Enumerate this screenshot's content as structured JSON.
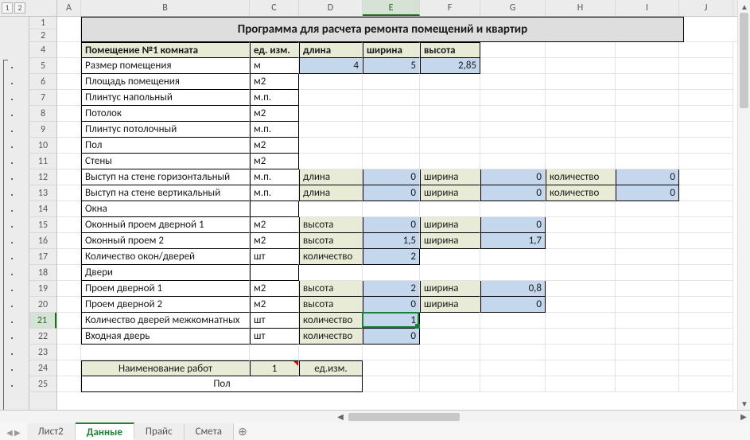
{
  "outline_levels": [
    "1",
    "2"
  ],
  "columns": [
    "A",
    "B",
    "C",
    "D",
    "E",
    "F",
    "G",
    "H",
    "I",
    "J"
  ],
  "selected_column": "E",
  "row_numbers": [
    1,
    2,
    4,
    5,
    6,
    7,
    8,
    9,
    10,
    11,
    12,
    13,
    14,
    15,
    16,
    17,
    18,
    19,
    20,
    21,
    22,
    23,
    24,
    25
  ],
  "selected_row": 21,
  "title": "Программа для расчета ремонта помещений и квартир",
  "header4": {
    "B": "Помещение №1 комната",
    "C": "ед. изм.",
    "D": "длина",
    "E": "ширина",
    "F": "высота"
  },
  "rows5_11": [
    {
      "b": "Размер помещения",
      "c": "м",
      "d": "4",
      "e": "5",
      "f": "2,85"
    },
    {
      "b": "Площадь помещения",
      "c": "м2"
    },
    {
      "b": "Плинтус напольный",
      "c": "м.п."
    },
    {
      "b": "Потолок",
      "c": "м2"
    },
    {
      "b": "Плинтус потолочный",
      "c": "м.п."
    },
    {
      "b": "Пол",
      "c": "м2"
    },
    {
      "b": "Стены",
      "c": "м2"
    }
  ],
  "row12": {
    "b": "Выступ на стене горизонтальный",
    "c": "м.п.",
    "d": "длина",
    "e": "0",
    "f": "ширина",
    "g": "0",
    "h": "количество",
    "i": "0"
  },
  "row13": {
    "b": "Выступ на стене вертикальный",
    "c": "м.п.",
    "d": "длина",
    "e": "0",
    "f": "ширина",
    "g": "0",
    "h": "количество",
    "i": "0"
  },
  "row14": {
    "b": "Окна"
  },
  "row15": {
    "b": "Оконный проем дверной 1",
    "c": "м2",
    "d": "высота",
    "e": "0",
    "f": "ширина",
    "g": "0"
  },
  "row16": {
    "b": "Оконный проем 2",
    "c": "м2",
    "d": "высота",
    "e": "1,5",
    "f": "ширина",
    "g": "1,7"
  },
  "row17": {
    "b": "Количество окон/дверей",
    "c": "шт",
    "d": "количество",
    "e": "2"
  },
  "row18": {
    "b": "Двери"
  },
  "row19": {
    "b": "Проем дверной 1",
    "c": "м2",
    "d": "высота",
    "e": "2",
    "f": "ширина",
    "g": "0,8"
  },
  "row20": {
    "b": "Проем дверной 2",
    "c": "м2",
    "d": "высота",
    "e": "0",
    "f": "ширина",
    "g": "0"
  },
  "row21": {
    "b": "Количество дверей межкомнатных",
    "c": "шт",
    "d": "количество",
    "e": "1"
  },
  "row22": {
    "b": "Входная дверь",
    "c": "шт",
    "d": "количество",
    "e": "0"
  },
  "row24": {
    "b": "Наименование работ",
    "c": "1",
    "d": "ед.изм."
  },
  "row25": {
    "b": "Пол"
  },
  "tabs": [
    "Лист2",
    "Данные",
    "Прайс",
    "Смета"
  ],
  "active_tab": "Данные",
  "active_cell_value": "1"
}
